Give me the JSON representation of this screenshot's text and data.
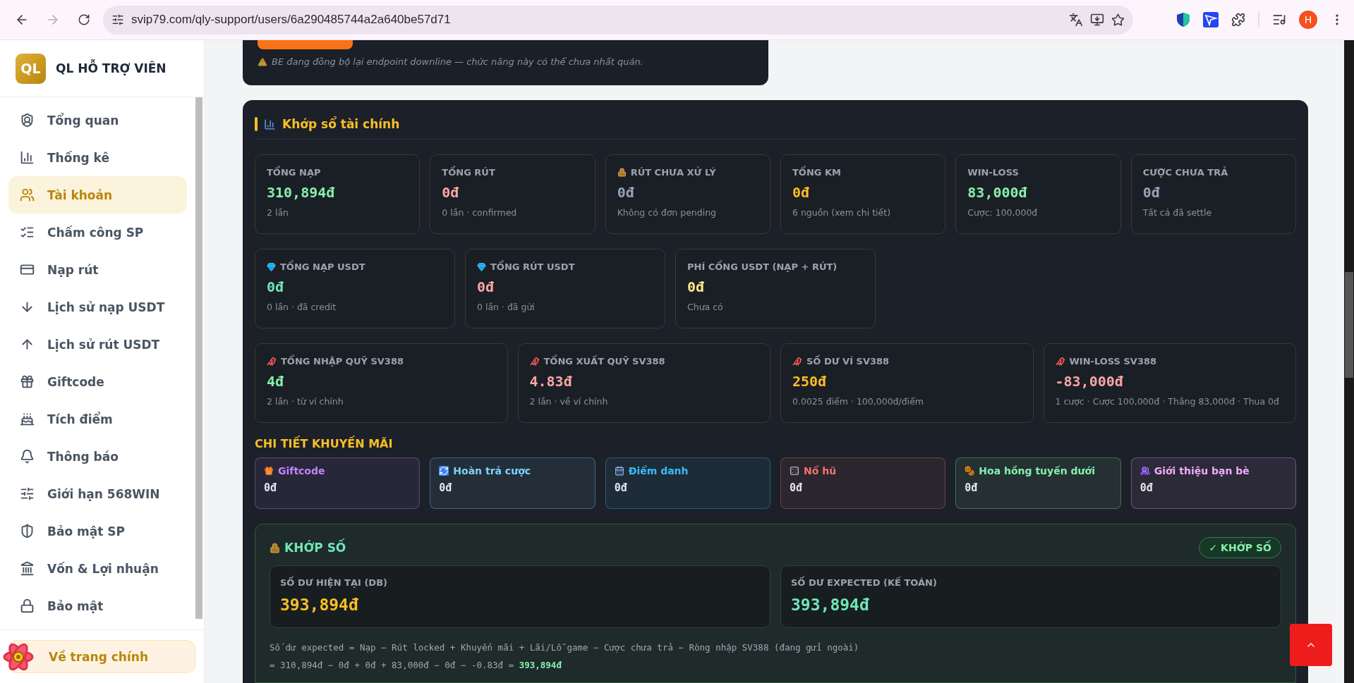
{
  "browser": {
    "url": "svip79.com/qly-support/users/6a290485744a2a640be57d71",
    "profile_letter": "H"
  },
  "sidebar": {
    "logo": "QL",
    "brand": "QL HỖ TRỢ VIÊN",
    "items": [
      {
        "label": "Tổng quan",
        "kind": "overview",
        "selected": false
      },
      {
        "label": "Thống kê",
        "kind": "stats",
        "selected": false
      },
      {
        "label": "Tài khoản",
        "kind": "users",
        "selected": true
      },
      {
        "label": "Chấm công SP",
        "kind": "checklist",
        "selected": false
      },
      {
        "label": "Nạp rút",
        "kind": "card",
        "selected": false
      },
      {
        "label": "Lịch sử nạp USDT",
        "kind": "down",
        "selected": false
      },
      {
        "label": "Lịch sử rút USDT",
        "kind": "up",
        "selected": false
      },
      {
        "label": "Giftcode",
        "kind": "gift",
        "selected": false
      },
      {
        "label": "Tích điểm",
        "kind": "cake",
        "selected": false
      },
      {
        "label": "Thông báo",
        "kind": "bell",
        "selected": false
      },
      {
        "label": "Giới hạn 568WIN",
        "kind": "sliders",
        "selected": false
      },
      {
        "label": "Bảo mật SP",
        "kind": "shield",
        "selected": false
      },
      {
        "label": "Vốn & Lợi nhuận",
        "kind": "bank",
        "selected": false
      },
      {
        "label": "Bảo mật",
        "kind": "lock",
        "selected": false
      }
    ],
    "footer_link": "Về trang chính"
  },
  "notice": {
    "text": "BE đang đồng bộ lại endpoint downline — chức năng này có thể chưa nhất quán."
  },
  "reconcile": {
    "title": "Khớp sổ tài chính",
    "summary": [
      {
        "kind": "plain",
        "label": "TỔNG NẠP",
        "value": "310,894đ",
        "sub": "2 lần",
        "color": "#86efac"
      },
      {
        "kind": "plain",
        "label": "TỔNG RÚT",
        "value": "0đ",
        "sub": "0 lần · confirmed",
        "color": "#fca5a5"
      },
      {
        "kind": "lock",
        "label": "RÚT CHƯA XỬ LÝ",
        "value": "0đ",
        "sub": "Không có đơn pending",
        "color": "#94a3b8"
      },
      {
        "kind": "plain",
        "label": "TỔNG KM",
        "value": "0đ",
        "sub": "6 nguồn (xem chi tiết)",
        "color": "#fbbf24"
      },
      {
        "kind": "plain",
        "label": "WIN-LOSS",
        "value": "83,000đ",
        "sub": "Cược: 100,000đ",
        "color": "#86efac"
      },
      {
        "kind": "plain",
        "label": "CƯỢC CHƯA TRẢ",
        "value": "0đ",
        "sub": "Tất cả đã settle",
        "color": "#94a3b8"
      }
    ],
    "usdt": [
      {
        "kind": "gem",
        "label": "TỔNG NẠP USDT",
        "value": "0đ",
        "sub": "0 lần · đã credit",
        "color": "#6ee7b7"
      },
      {
        "kind": "gem",
        "label": "TỔNG RÚT USDT",
        "value": "0đ",
        "sub": "0 lần · đã gửi",
        "color": "#fca5a5"
      },
      {
        "kind": "plain",
        "label": "PHÍ CỔNG USDT (NẠP + RÚT)",
        "value": "0đ",
        "sub": "Chưa có",
        "color": "#fde68a"
      }
    ],
    "sv388": [
      {
        "kind": "rooster",
        "label": "TỔNG NHẬP QUỸ SV388",
        "value": "4đ",
        "sub": "2 lần · từ ví chính",
        "color": "#86efac"
      },
      {
        "kind": "rooster",
        "label": "TỔNG XUẤT QUỸ SV388",
        "value": "4.83đ",
        "sub": "2 lần · về ví chính",
        "color": "#fca5a5"
      },
      {
        "kind": "rooster",
        "label": "SỐ DƯ VÍ SV388",
        "value": "250đ",
        "sub": "0.0025 điểm · 100,000đ/điểm",
        "color": "#fbbf24"
      },
      {
        "kind": "rooster",
        "label": "WIN-LOSS SV388",
        "value": "-83,000đ",
        "sub": "1 cược · Cược 100,000đ · Thắng 83,000đ · Thua 0đ",
        "color": "#fca5a5"
      }
    ],
    "promo_title": "CHI TIẾT KHUYẾN MÃI",
    "promos": [
      {
        "kind": "gift",
        "label": "Giftcode",
        "value": "0đ",
        "color": "#c084fc"
      },
      {
        "kind": "refund",
        "label": "Hoàn trả cược",
        "value": "0đ",
        "color": "#7dd3fc"
      },
      {
        "kind": "calendar",
        "label": "Điểm danh",
        "value": "0đ",
        "color": "#38bdf8"
      },
      {
        "kind": "slot",
        "label": "Nổ hũ",
        "value": "0đ",
        "color": "#f87171"
      },
      {
        "kind": "money",
        "label": "Hoa hồng tuyến dưới",
        "value": "0đ",
        "color": "#86efac"
      },
      {
        "kind": "people",
        "label": "Giới thiệu bạn bè",
        "value": "0đ",
        "color": "#f0abfc"
      }
    ],
    "match": {
      "title": "KHỚP SỐ",
      "badge": "✓ KHỚP SỐ",
      "balances": [
        {
          "label": "SỐ DƯ HIỆN TẠI (DB)",
          "value": "393,894đ",
          "color": "#fbbf24"
        },
        {
          "label": "SỐ DƯ EXPECTED (KẾ TOÁN)",
          "value": "393,894đ",
          "color": "#6ee7b7"
        }
      ],
      "formula": "Số dư expected = Nạp − Rút locked + Khuyến mãi + Lãi/Lỗ game − Cược chưa trả − Ròng nhập SV388 (đang gửi ngoài)",
      "calculation": "= 310,894đ − 0đ + 0đ + 83,000đ − 0đ − -0.83đ = **393,894đ**"
    }
  }
}
